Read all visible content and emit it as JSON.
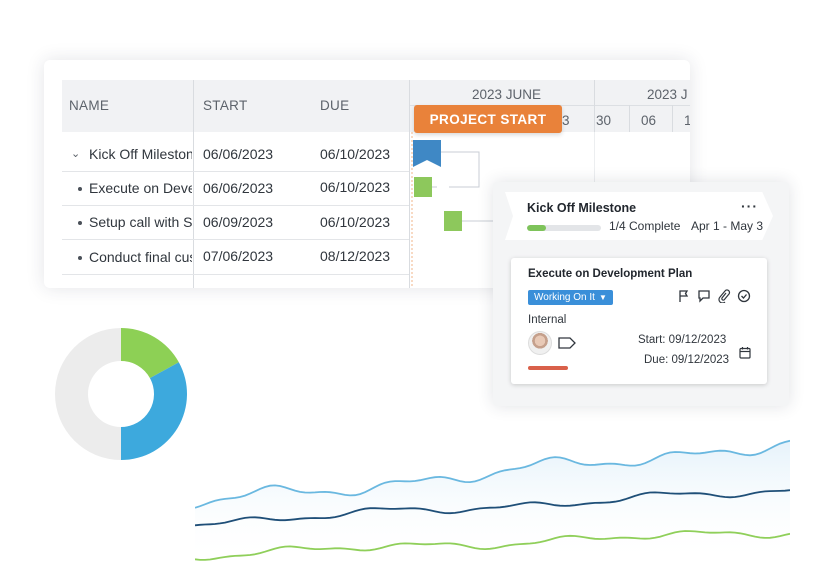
{
  "gantt": {
    "columns": {
      "name": "NAME",
      "start": "START",
      "due": "DUE"
    },
    "months": [
      "2023 JUNE",
      "2023 J"
    ],
    "days": [
      "3",
      "30",
      "06",
      "1"
    ],
    "project_start_label": "PROJECT START",
    "rows": [
      {
        "name": "Kick Off Milestone",
        "start": "06/06/2023",
        "due": "06/10/2023",
        "kind": "group"
      },
      {
        "name": "Execute on Development Plan",
        "start": "06/06/2023",
        "due": "06/10/2023",
        "kind": "task"
      },
      {
        "name": "Setup call with Stakeholders",
        "start": "06/09/2023",
        "due": "06/10/2023",
        "kind": "task"
      },
      {
        "name": "Conduct final customer review",
        "start": "07/06/2023",
        "due": "08/12/2023",
        "kind": "task"
      }
    ]
  },
  "milestone": {
    "title": "Kick Off Milestone",
    "menu": "···",
    "progress_fraction": 0.25,
    "complete_text": "1/4 Complete",
    "date_range": "Apr 1 - May 3"
  },
  "task_card": {
    "title": "Execute on Development Plan",
    "status": "Working On It",
    "category": "Internal",
    "start": "Start: 09/12/2023",
    "due": "Due: 09/12/2023"
  },
  "donut": {
    "segments": [
      {
        "label": "green",
        "fraction": 0.17,
        "color": "#8dd055"
      },
      {
        "label": "blue",
        "fraction": 0.33,
        "color": "#3da9dd"
      },
      {
        "label": "gray",
        "fraction": 0.5,
        "color": "#ececec"
      }
    ]
  },
  "colors": {
    "orange": "#e9823a",
    "milestone_blue": "#3f88c5",
    "task_green": "#8dc85c",
    "status_blue": "#3a8fd9",
    "wave_light_blue": "#6ab8e0",
    "wave_dark_blue": "#1f4f78",
    "wave_green": "#8fcf5a"
  }
}
